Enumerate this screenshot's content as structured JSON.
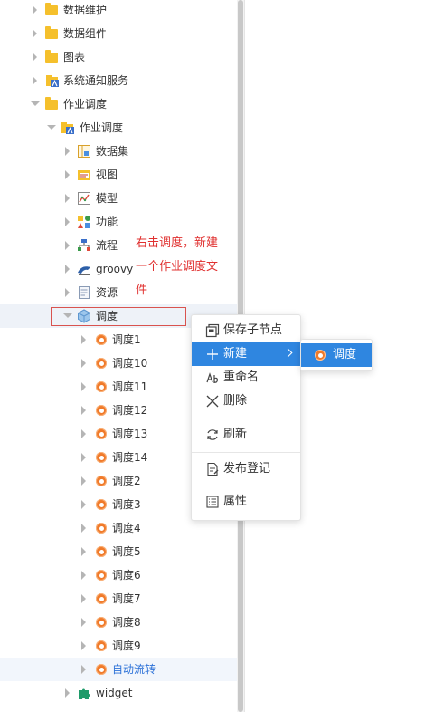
{
  "tree": {
    "nodes": [
      {
        "label": "数据维护",
        "icon": "folder-icon",
        "caret": "right"
      },
      {
        "label": "数据组件",
        "icon": "folder-icon",
        "caret": "right"
      },
      {
        "label": "图表",
        "icon": "folder-icon",
        "caret": "right"
      },
      {
        "label": "系统通知服务",
        "icon": "folder-service-icon",
        "caret": "right"
      },
      {
        "label": "作业调度",
        "icon": "folder-icon",
        "caret": "down"
      },
      {
        "label": "作业调度",
        "icon": "folder-service-icon",
        "caret": "down"
      },
      {
        "label": "数据集",
        "icon": "dataset-icon",
        "caret": "right"
      },
      {
        "label": "视图",
        "icon": "view-icon",
        "caret": "right"
      },
      {
        "label": "模型",
        "icon": "model-icon",
        "caret": "right"
      },
      {
        "label": "功能",
        "icon": "function-icon",
        "caret": "right"
      },
      {
        "label": "流程",
        "icon": "flow-icon",
        "caret": "right"
      },
      {
        "label": "groovy",
        "icon": "groovy-icon",
        "caret": "right"
      },
      {
        "label": "资源",
        "icon": "resource-icon",
        "caret": "right"
      },
      {
        "label": "调度",
        "icon": "schedule-cube-icon",
        "caret": "down"
      },
      {
        "label": "调度1",
        "icon": "gear-icon",
        "caret": "right"
      },
      {
        "label": "调度10",
        "icon": "gear-icon",
        "caret": "right"
      },
      {
        "label": "调度11",
        "icon": "gear-icon",
        "caret": "right"
      },
      {
        "label": "调度12",
        "icon": "gear-icon",
        "caret": "right"
      },
      {
        "label": "调度13",
        "icon": "gear-icon",
        "caret": "right"
      },
      {
        "label": "调度14",
        "icon": "gear-icon",
        "caret": "right"
      },
      {
        "label": "调度2",
        "icon": "gear-icon",
        "caret": "right"
      },
      {
        "label": "调度3",
        "icon": "gear-icon",
        "caret": "right"
      },
      {
        "label": "调度4",
        "icon": "gear-icon",
        "caret": "right"
      },
      {
        "label": "调度5",
        "icon": "gear-icon",
        "caret": "right"
      },
      {
        "label": "调度6",
        "icon": "gear-icon",
        "caret": "right"
      },
      {
        "label": "调度7",
        "icon": "gear-icon",
        "caret": "right"
      },
      {
        "label": "调度8",
        "icon": "gear-icon",
        "caret": "right"
      },
      {
        "label": "调度9",
        "icon": "gear-icon",
        "caret": "right"
      },
      {
        "label": "自动流转",
        "icon": "gear-icon",
        "caret": "right"
      },
      {
        "label": "widget",
        "icon": "puzzle-icon",
        "caret": "right"
      }
    ]
  },
  "annotation": {
    "line1": "右击调度，新建",
    "line2": "一个作业调度文",
    "line3": "件",
    "color": "#e0302f"
  },
  "context_menu": {
    "items": [
      {
        "label": "保存子节点",
        "icon": "save-node-icon"
      },
      {
        "label": "新建",
        "icon": "plus-icon",
        "active": true,
        "has_submenu": true
      },
      {
        "label": "重命名",
        "icon": "rename-icon"
      },
      {
        "label": "删除",
        "icon": "close-icon"
      },
      {
        "label": "刷新",
        "icon": "refresh-icon"
      },
      {
        "label": "发布登记",
        "icon": "publish-icon"
      },
      {
        "label": "属性",
        "icon": "properties-icon"
      }
    ],
    "submenu": {
      "label": "调度",
      "icon": "gear-icon"
    }
  },
  "colors": {
    "accent": "#2f86e0",
    "selected_label": "#2f73d8",
    "folder": "#f5c02c",
    "gear": "#f07a2a"
  }
}
